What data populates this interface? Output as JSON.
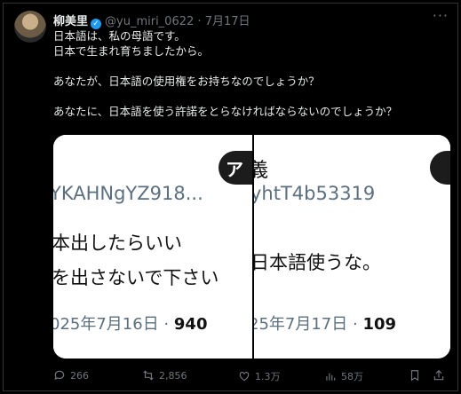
{
  "author": {
    "name": "柳美里",
    "handle": "@yu_miri_0622",
    "separator": "·",
    "date": "7月17日"
  },
  "tweet": {
    "lines": [
      "日本語は、私の母語です。",
      "日本で生まれ育ちましたから。",
      "",
      "あなたが、日本語の使用権をお持ちなのでしょうか？",
      "",
      "あなたに、日本語を使う許諾をとらなければならないのでしょうか？"
    ]
  },
  "media": {
    "left": {
      "pill_text": "ア",
      "code": "YKAHNgYZ918...",
      "line1": "本出したらいい",
      "line2": "を出さないで下さい",
      "date": "025年7月16日 · ",
      "count": "940"
    },
    "right": {
      "kanji": "義",
      "code": "yhtT4b53319",
      "line1": "日本語使うな。",
      "date": "25年7月17日 · ",
      "count": "109"
    }
  },
  "actions": {
    "replies": "266",
    "retweets": "2,856",
    "likes": "1.3万",
    "views": "58万"
  },
  "colors": {
    "verified": "#1d9bf0",
    "muted": "#71767b",
    "background": "#000000"
  }
}
